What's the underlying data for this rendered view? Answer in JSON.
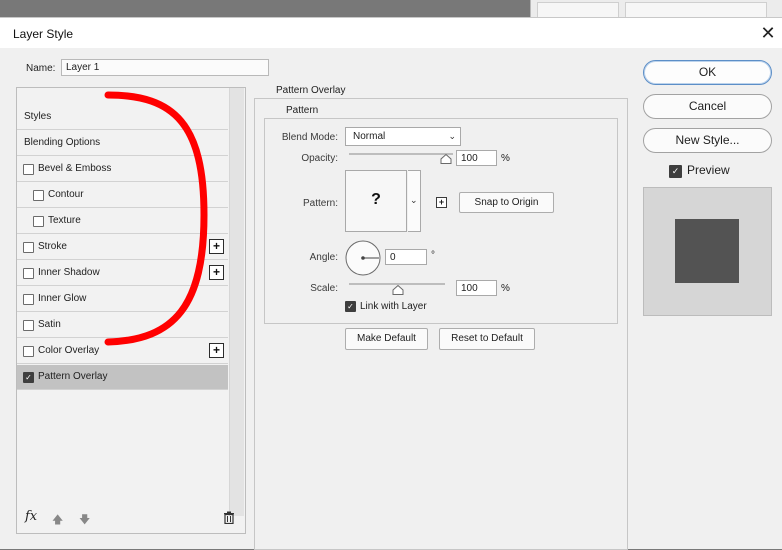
{
  "window": {
    "title": "Layer Style"
  },
  "name_field": {
    "label": "Name:",
    "value": "Layer 1"
  },
  "styles_list": [
    {
      "label": "Styles",
      "has_checkbox": false,
      "checked": false,
      "indent": false,
      "has_plus": false,
      "selected": false
    },
    {
      "label": "Blending Options",
      "has_checkbox": false,
      "checked": false,
      "indent": false,
      "has_plus": false,
      "selected": false
    },
    {
      "label": "Bevel & Emboss",
      "has_checkbox": true,
      "checked": false,
      "indent": false,
      "has_plus": false,
      "selected": false
    },
    {
      "label": "Contour",
      "has_checkbox": true,
      "checked": false,
      "indent": true,
      "has_plus": false,
      "selected": false
    },
    {
      "label": "Texture",
      "has_checkbox": true,
      "checked": false,
      "indent": true,
      "has_plus": false,
      "selected": false
    },
    {
      "label": "Stroke",
      "has_checkbox": true,
      "checked": false,
      "indent": false,
      "has_plus": true,
      "selected": false
    },
    {
      "label": "Inner Shadow",
      "has_checkbox": true,
      "checked": false,
      "indent": false,
      "has_plus": true,
      "selected": false
    },
    {
      "label": "Inner Glow",
      "has_checkbox": true,
      "checked": false,
      "indent": false,
      "has_plus": false,
      "selected": false
    },
    {
      "label": "Satin",
      "has_checkbox": true,
      "checked": false,
      "indent": false,
      "has_plus": false,
      "selected": false
    },
    {
      "label": "Color Overlay",
      "has_checkbox": true,
      "checked": false,
      "indent": false,
      "has_plus": true,
      "selected": false
    },
    {
      "label": "Pattern Overlay",
      "has_checkbox": true,
      "checked": true,
      "indent": false,
      "has_plus": false,
      "selected": true
    }
  ],
  "bottom_icons": {
    "fx": "fx",
    "move_up": "arrow-up-icon",
    "move_down": "arrow-down-icon",
    "delete": "trash-icon"
  },
  "pattern_overlay": {
    "section_title": "Pattern Overlay",
    "group_title": "Pattern",
    "blend_mode": {
      "label": "Blend Mode:",
      "value": "Normal"
    },
    "opacity": {
      "label": "Opacity:",
      "value": "100",
      "unit": "%",
      "level": 1.0
    },
    "pattern": {
      "label": "Pattern:",
      "swatch_text": "?"
    },
    "snap_button": "Snap to Origin",
    "angle": {
      "label": "Angle:",
      "value": "0",
      "unit": "°"
    },
    "scale": {
      "label": "Scale:",
      "value": "100",
      "unit": "%",
      "level": 0.5
    },
    "link_with_layer": {
      "label": "Link with Layer",
      "checked": true
    },
    "make_default": "Make Default",
    "reset_default": "Reset to Default"
  },
  "right_buttons": {
    "ok": "OK",
    "cancel": "Cancel",
    "new_style": "New Style..."
  },
  "preview": {
    "label": "Preview",
    "checked": true,
    "swatch_color": "#535353"
  },
  "annotation": {
    "color": "#ff0000",
    "shape": "red-bracket-stroke"
  }
}
